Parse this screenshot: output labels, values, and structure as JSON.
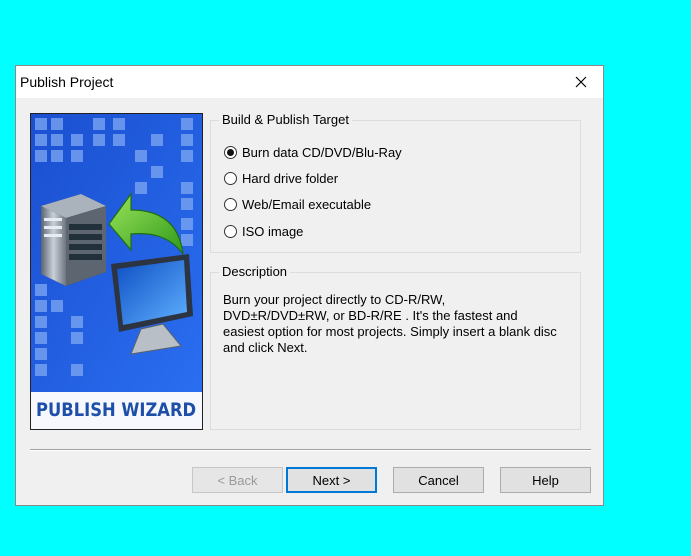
{
  "window": {
    "title": "Publish Project",
    "close_icon": "close-icon"
  },
  "wizard_image": {
    "banner_text": "PUBLISH WIZARD",
    "colors": {
      "background": "#1c56d6",
      "banner_bg": "#f6f8fd",
      "banner_text": "#1d4fa8"
    }
  },
  "target_group": {
    "label": "Build & Publish Target",
    "options": [
      {
        "label": "Burn data CD/DVD/Blu-Ray",
        "checked": true
      },
      {
        "label": "Hard drive folder",
        "checked": false
      },
      {
        "label": "Web/Email executable",
        "checked": false
      },
      {
        "label": "ISO image",
        "checked": false
      }
    ]
  },
  "description_group": {
    "label": "Description",
    "lines": [
      "Burn your project directly to CD-R/RW,",
      "DVD±R/DVD±RW, or BD-R/RE . It's the fastest and",
      "easiest option for most projects. Simply insert a blank disc",
      "and click Next."
    ]
  },
  "buttons": {
    "back": "< Back",
    "next": "Next >",
    "cancel": "Cancel",
    "help": "Help"
  }
}
